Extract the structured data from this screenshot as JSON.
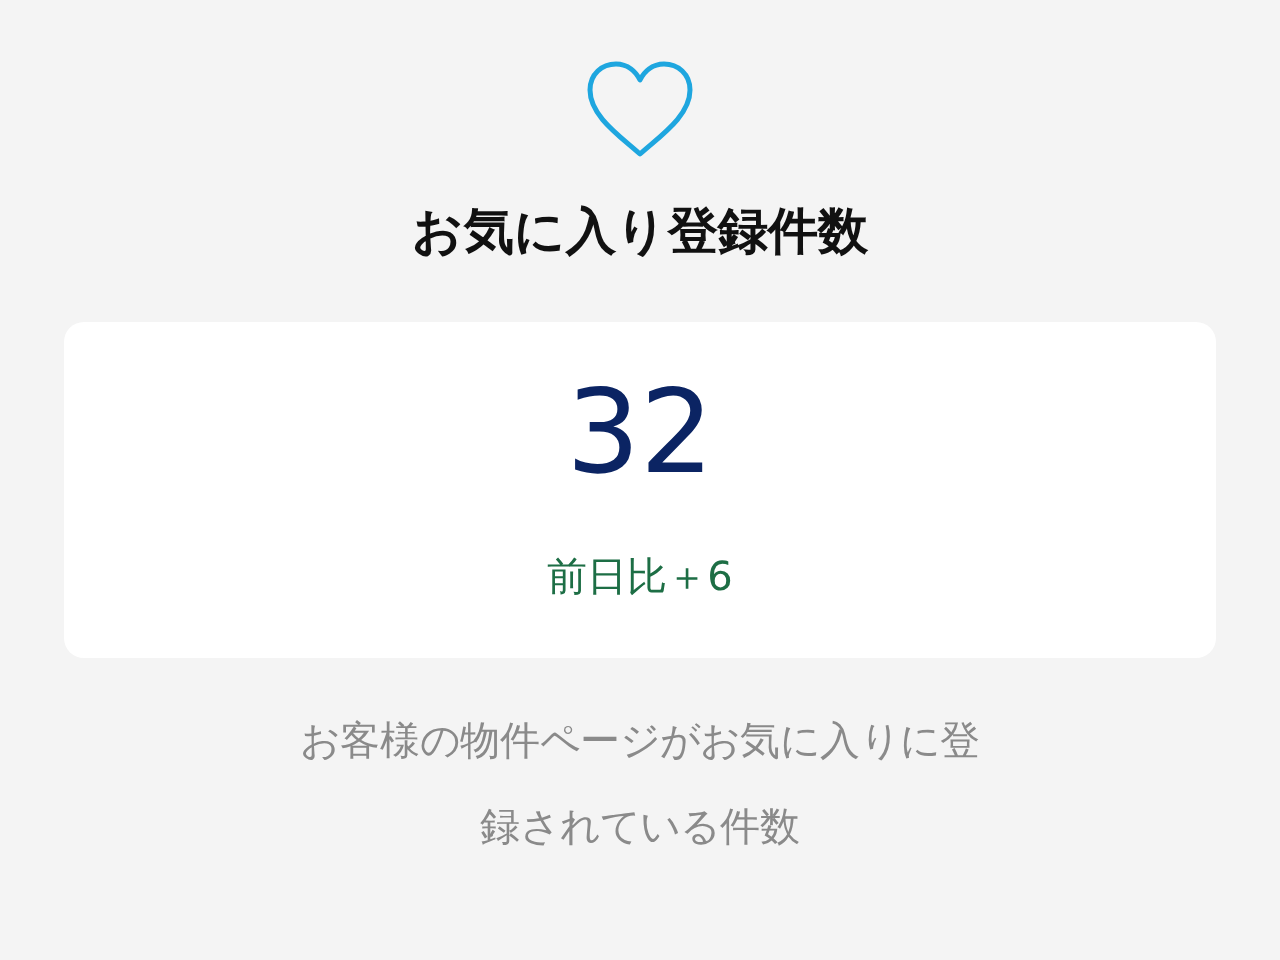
{
  "title": "お気に入り登録件数",
  "count": "32",
  "change": "前日比＋6",
  "description": "お客様の物件ページがお気に入りに登録されている件数"
}
